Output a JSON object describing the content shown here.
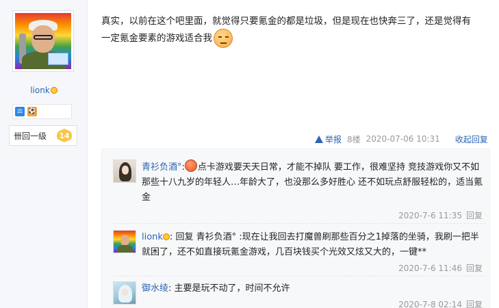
{
  "user": {
    "username": "lionk",
    "level_label": "卌回一级",
    "level_number": "14"
  },
  "post": {
    "text_line1": "真实，以前在这个吧里面，就觉得只要氪金的都是垃圾，但是现在也快奔三了，还是觉得有",
    "text_line2": "一定氪金要素的游戏适合我",
    "report_label": "举报",
    "floor": "8楼",
    "timestamp": "2020-07-06 10:31",
    "collapse_label": "收起回复"
  },
  "replies": [
    {
      "username": "青衫负酒°",
      "separator": ":",
      "text": "点卡游戏要天天日常，才能不掉队 要工作，很难坚持 竞技游戏你又不如那些十八九岁的年轻人…年龄大了，也没那么多好胜心 还不如玩点舒服轻松的，适当氪金",
      "time": "2020-7-6 11:35",
      "reply_label": "回复"
    },
    {
      "username": "lionk",
      "text": ": 回复 青衫负酒° :现在让我回去打魔兽刷那些百分之1掉落的坐骑，我刷一把半就困了，还不如直接玩氪金游戏，几百块钱买个光效又炫又大的，一键**",
      "time": "2020-7-6 11:46",
      "reply_label": "回复"
    },
    {
      "username": "御水绫",
      "text": ": 主要是玩不动了，时间不允许",
      "time": "2020-7-8 02:14",
      "reply_label": "回复"
    }
  ],
  "icons": {
    "avatar": "user-avatar",
    "report": "warning-icon",
    "emoji": "unamused-face-emoji"
  }
}
